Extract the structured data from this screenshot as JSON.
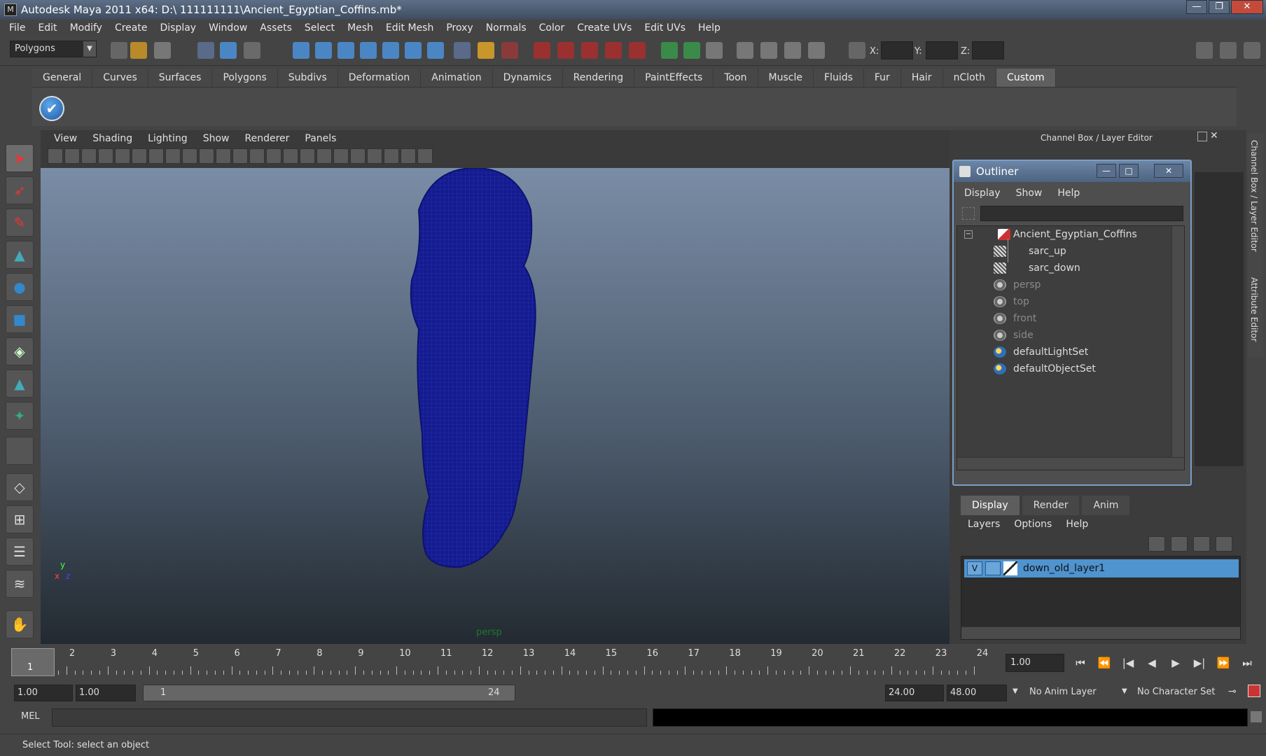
{
  "window": {
    "title": "Autodesk Maya 2011 x64: D:\\ 111111111\\Ancient_Egyptian_Coffins.mb*",
    "min": "—",
    "max": "❐",
    "close": "✕"
  },
  "menubar": [
    "File",
    "Edit",
    "Modify",
    "Create",
    "Display",
    "Window",
    "Assets",
    "Select",
    "Mesh",
    "Edit Mesh",
    "Proxy",
    "Normals",
    "Color",
    "Create UVs",
    "Edit UVs",
    "Help"
  ],
  "statusline": {
    "mode": "Polygons",
    "x_label": "X:",
    "y_label": "Y:",
    "z_label": "Z:"
  },
  "shelf": {
    "tabs": [
      "General",
      "Curves",
      "Surfaces",
      "Polygons",
      "Subdivs",
      "Deformation",
      "Animation",
      "Dynamics",
      "Rendering",
      "PaintEffects",
      "Toon",
      "Muscle",
      "Fluids",
      "Fur",
      "Hair",
      "nCloth",
      "Custom"
    ],
    "active": "Custom"
  },
  "panel": {
    "menus": [
      "View",
      "Shading",
      "Lighting",
      "Show",
      "Renderer",
      "Panels"
    ],
    "camera_label": "persp"
  },
  "channelbox": {
    "title": "Channel Box / Layer Editor"
  },
  "outliner": {
    "title": "Outliner",
    "menus": [
      "Display",
      "Show",
      "Help"
    ],
    "items": [
      {
        "label": "Ancient_Egyptian_Coffins",
        "icon": "transform-icon",
        "dim": false
      },
      {
        "label": "sarc_up",
        "icon": "mesh-icon",
        "dim": false
      },
      {
        "label": "sarc_down",
        "icon": "mesh-icon",
        "dim": false
      },
      {
        "label": "persp",
        "icon": "camera-icon",
        "dim": true
      },
      {
        "label": "top",
        "icon": "camera-icon",
        "dim": true
      },
      {
        "label": "front",
        "icon": "camera-icon",
        "dim": true
      },
      {
        "label": "side",
        "icon": "camera-icon",
        "dim": true
      },
      {
        "label": "defaultLightSet",
        "icon": "set-icon",
        "dim": false
      },
      {
        "label": "defaultObjectSet",
        "icon": "set-icon",
        "dim": false
      }
    ]
  },
  "layers": {
    "tabs": [
      "Display",
      "Render",
      "Anim"
    ],
    "active_tab": "Display",
    "menus": [
      "Layers",
      "Options",
      "Help"
    ],
    "rows": [
      {
        "visible": "V",
        "name": "down_old_layer1"
      }
    ]
  },
  "side_tabs": [
    "Channel Box / Layer Editor",
    "Attribute Editor"
  ],
  "timeline": {
    "ticks": [
      "1",
      "2",
      "3",
      "4",
      "5",
      "6",
      "7",
      "8",
      "9",
      "10",
      "11",
      "12",
      "13",
      "14",
      "15",
      "16",
      "17",
      "18",
      "19",
      "20",
      "21",
      "22",
      "23",
      "24"
    ],
    "current_frame": "1",
    "current_field": "1.00"
  },
  "playback": [
    "⏮",
    "⏪",
    "|◀",
    "◀",
    "▶",
    "▶|",
    "⏩",
    "⏭"
  ],
  "range": {
    "start": "1.00",
    "playback_start": "1.00",
    "slider_start": "1",
    "slider_end": "24",
    "playback_end": "24.00",
    "end": "48.00",
    "anim_layer": "No Anim Layer",
    "character_set": "No Character Set"
  },
  "cmd": {
    "label": "MEL"
  },
  "help": {
    "text": "Select Tool: select an object"
  },
  "colors": {
    "mesh": "#121a8a",
    "selection": "#4f93cf"
  }
}
